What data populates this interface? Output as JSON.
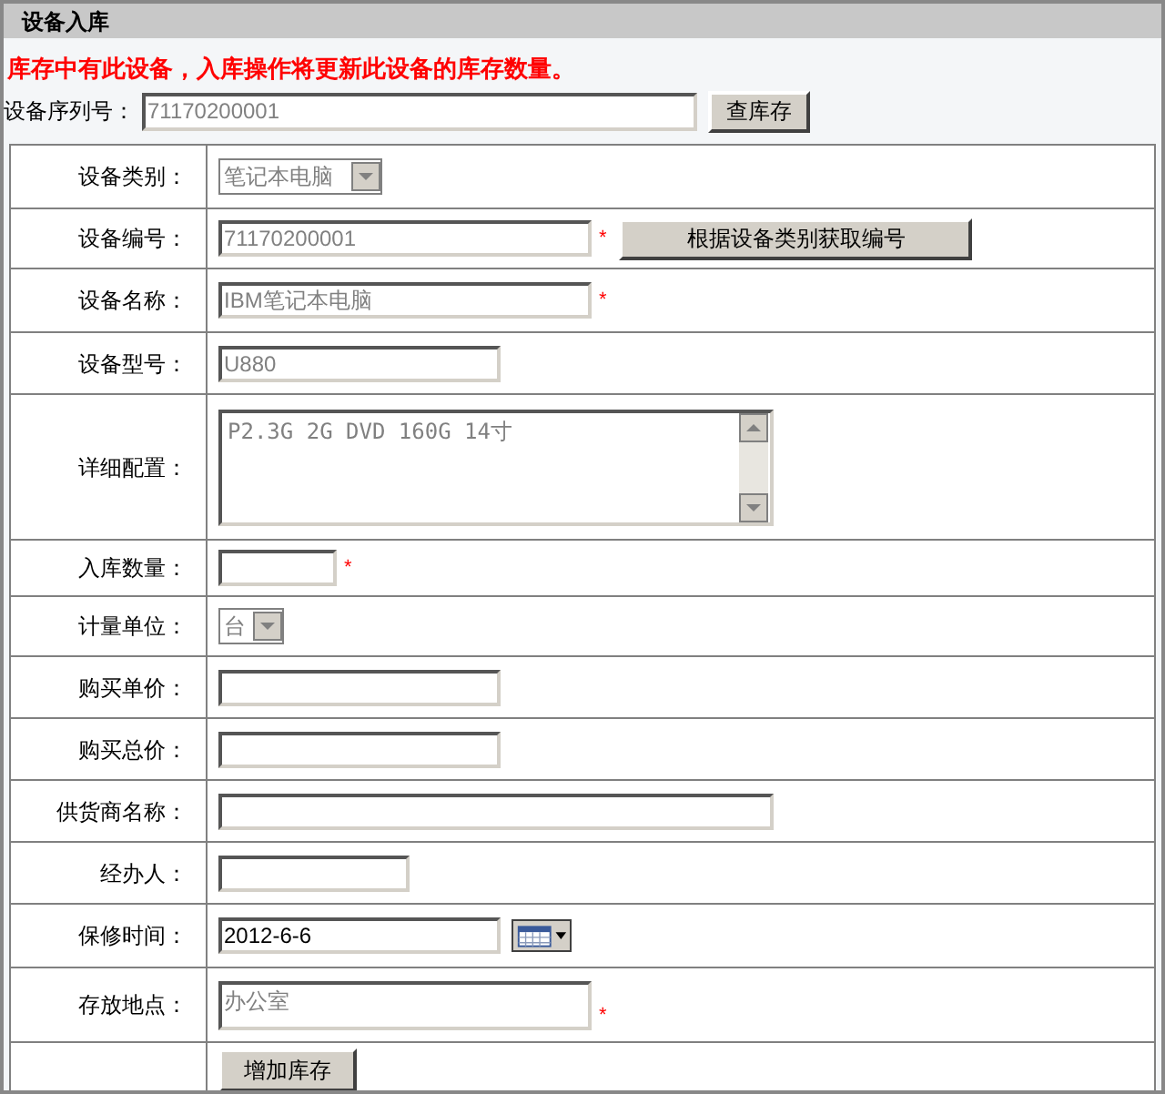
{
  "panel_title": "设备入库",
  "message": "库存中有此设备，入库操作将更新此设备的库存数量。",
  "serial": {
    "label": "设备序列号：",
    "value": "71170200001",
    "disabled": true,
    "button": "查库存"
  },
  "required_mark": "*",
  "rows": [
    {
      "kind": "select",
      "label": "设备类别：",
      "value": "笔记本电脑",
      "disabled": true
    },
    {
      "kind": "text",
      "label": "设备编号：",
      "value": "71170200001",
      "disabled": true,
      "required": true,
      "button": "根据设备类别获取编号"
    },
    {
      "kind": "text",
      "label": "设备名称：",
      "value": "IBM笔记本电脑",
      "disabled": true,
      "required": true
    },
    {
      "kind": "text",
      "label": "设备型号：",
      "value": "U880",
      "disabled": true
    },
    {
      "kind": "textarea",
      "label": "详细配置：",
      "value": "P2.3G 2G DVD 160G 14寸",
      "disabled": true
    },
    {
      "kind": "text",
      "label": "入库数量：",
      "required": true
    },
    {
      "kind": "select",
      "label": "计量单位：",
      "value": "台",
      "disabled": true
    },
    {
      "kind": "text",
      "label": "购买单价："
    },
    {
      "kind": "text",
      "label": "购买总价："
    },
    {
      "kind": "text",
      "label": "供货商名称："
    },
    {
      "kind": "text",
      "label": "经办人："
    },
    {
      "kind": "date",
      "label": "保修时间：",
      "value": "2012-6-6",
      "disabled": false
    },
    {
      "kind": "textarea",
      "label": "存放地点：",
      "value": "办公室",
      "disabled": true,
      "required": true
    },
    {
      "kind": "submit",
      "button": "增加库存"
    }
  ]
}
